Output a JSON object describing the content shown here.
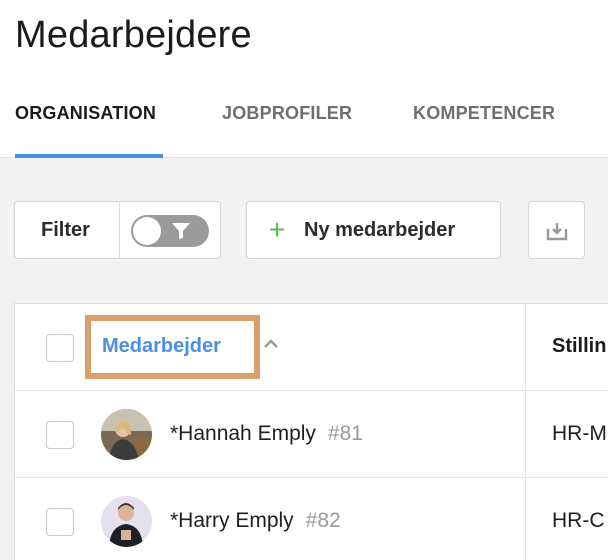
{
  "page": {
    "title": "Medarbejdere"
  },
  "tabs": [
    {
      "label": "ORGANISATION",
      "active": true
    },
    {
      "label": "JOBPROFILER",
      "active": false
    },
    {
      "label": "KOMPETENCER",
      "active": false
    }
  ],
  "toolbar": {
    "filter_label": "Filter",
    "filter_toggle_on": false,
    "new_employee_label": "Ny medarbejder",
    "export_icon": "download-tray-icon"
  },
  "table": {
    "columns": {
      "employee": "Medarbejder",
      "title": "Stillin"
    },
    "sort": {
      "column": "employee",
      "direction": "ascending"
    },
    "rows": [
      {
        "name": "*Hannah Emply",
        "id": "#81",
        "title": "HR-M"
      },
      {
        "name": "*Harry Emply",
        "id": "#82",
        "title": "HR-C"
      }
    ]
  },
  "colors": {
    "accent": "#4a90e2",
    "highlight": "#d9a06b",
    "plus": "#5cb85c",
    "toggle_off": "#9b9b9b"
  }
}
